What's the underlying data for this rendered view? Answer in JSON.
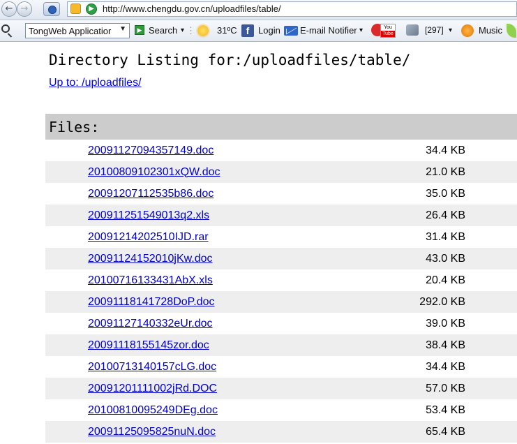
{
  "browser": {
    "url": "http://www.chengdu.gov.cn/uploadfiles/table/"
  },
  "toolbar": {
    "combo_value": "TongWeb Applicatior",
    "search_label": "Search",
    "weather": "31ºC",
    "login_label": "Login",
    "email_label": "E-mail Notifier",
    "youtube_top": "You",
    "youtube_bottom": "Tube",
    "count_badge": "[297]",
    "music_label": "Music"
  },
  "page": {
    "title": "Directory Listing for:/uploadfiles/table/",
    "up_link": "Up to: /uploadfiles/",
    "files_header": "Files:",
    "files": [
      {
        "name": "20091127094357149.doc",
        "size": "34.4 KB"
      },
      {
        "name": "20100809102301xQW.doc",
        "size": "21.0 KB"
      },
      {
        "name": "20091207112535b86.doc",
        "size": "35.0 KB"
      },
      {
        "name": "200911251549013q2.xls",
        "size": "26.4 KB"
      },
      {
        "name": "20091214202510IJD.rar",
        "size": "31.4 KB"
      },
      {
        "name": "20091124152010jKw.doc",
        "size": "43.0 KB"
      },
      {
        "name": "20100716133431AbX.xls",
        "size": "20.4 KB"
      },
      {
        "name": "20091118141728DoP.doc",
        "size": "292.0 KB"
      },
      {
        "name": "20091127140332eUr.doc",
        "size": "39.0 KB"
      },
      {
        "name": "20091118155145zor.doc",
        "size": "38.4 KB"
      },
      {
        "name": "20100713140157cLG.doc",
        "size": "34.4 KB"
      },
      {
        "name": "20091201111002jRd.DOC",
        "size": "57.0 KB"
      },
      {
        "name": "20100810095249DEg.doc",
        "size": "53.4 KB"
      },
      {
        "name": "20091125095825nuN.doc",
        "size": "65.4 KB"
      }
    ]
  }
}
